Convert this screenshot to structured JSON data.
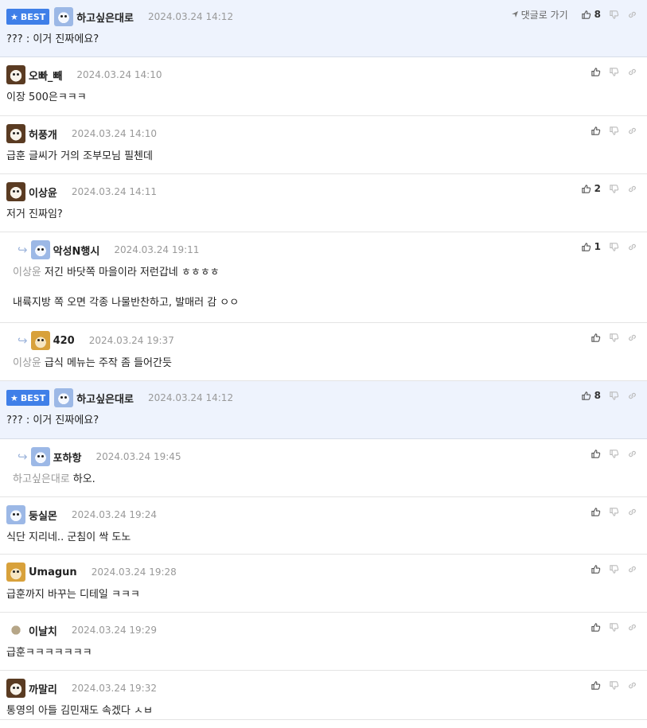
{
  "labels": {
    "best": "BEST",
    "goto": "댓글로 가기"
  },
  "comments": [
    {
      "nick": "하고싶은대로",
      "date": "2024.03.24 14:12",
      "best": true,
      "first": true,
      "reply": false,
      "avatar": "blue",
      "mention": "",
      "lines": [
        "??? : 이거 진짜에요?"
      ],
      "likes": "8",
      "goto": true
    },
    {
      "nick": "오빠_빼",
      "date": "2024.03.24 14:10",
      "best": false,
      "reply": false,
      "avatar": "dog",
      "mention": "",
      "lines": [
        "이장 500은ㅋㅋㅋ"
      ],
      "likes": ""
    },
    {
      "nick": "허풍개",
      "date": "2024.03.24 14:10",
      "best": false,
      "reply": false,
      "avatar": "dog",
      "mention": "",
      "lines": [
        "급훈 글씨가 거의 조부모님 필첸데"
      ],
      "likes": ""
    },
    {
      "nick": "이상윤",
      "date": "2024.03.24 14:11",
      "best": false,
      "reply": false,
      "avatar": "dog",
      "mention": "",
      "lines": [
        "저거 진짜임?"
      ],
      "likes": "2"
    },
    {
      "nick": "악성N행시",
      "date": "2024.03.24 19:11",
      "best": false,
      "reply": true,
      "avatar": "blue",
      "mention": "이상윤",
      "lines": [
        "저긴 바닷쪽 마을이라 저런갑네 ㅎㅎㅎㅎ",
        "내륙지방 쪽 오면 각종 나물반찬하고, 발매러 감 ㅇㅇ"
      ],
      "likes": "1"
    },
    {
      "nick": "420",
      "date": "2024.03.24 19:37",
      "best": false,
      "reply": true,
      "avatar": "fox",
      "mention": "이상윤",
      "lines": [
        "급식 메뉴는 주작 좀 들어간듯"
      ],
      "likes": ""
    },
    {
      "nick": "하고싶은대로",
      "date": "2024.03.24 14:12",
      "best": true,
      "first": false,
      "reply": false,
      "avatar": "blue",
      "mention": "",
      "lines": [
        "??? : 이거 진짜에요?"
      ],
      "likes": "8"
    },
    {
      "nick": "포하항",
      "date": "2024.03.24 19:45",
      "best": false,
      "reply": true,
      "avatar": "blue",
      "mention": "하고싶은대로",
      "lines": [
        "하오."
      ],
      "likes": ""
    },
    {
      "nick": "둥실몬",
      "date": "2024.03.24 19:24",
      "best": false,
      "reply": false,
      "avatar": "blue",
      "mention": "",
      "lines": [
        "식단 지리네.. 군침이 싹 도노"
      ],
      "likes": ""
    },
    {
      "nick": "Umagun",
      "date": "2024.03.24 19:28",
      "best": false,
      "reply": false,
      "avatar": "fox",
      "mention": "",
      "lines": [
        "급훈까지 바꾸는 디테일 ㅋㅋㅋ"
      ],
      "likes": ""
    },
    {
      "nick": "이날치",
      "date": "2024.03.24 19:29",
      "best": false,
      "reply": false,
      "avatar": "dot",
      "mention": "",
      "lines": [
        "급훈ㅋㅋㅋㅋㅋㅋㅋ"
      ],
      "likes": ""
    },
    {
      "nick": "까말리",
      "date": "2024.03.24 19:32",
      "best": false,
      "reply": false,
      "avatar": "dog",
      "mention": "",
      "lines": [
        "통영의 아들 김민재도 속겠다 ㅅㅂ"
      ],
      "likes": ""
    }
  ]
}
